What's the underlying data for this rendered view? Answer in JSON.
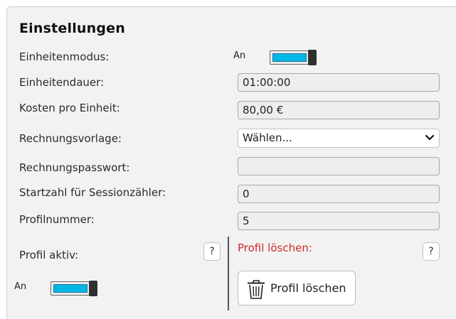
{
  "settings": {
    "title": "Einstellungen",
    "unit_mode": {
      "label": "Einheitenmodus:",
      "toggle_text": "An",
      "enabled": true
    },
    "unit_duration": {
      "label": "Einheitendauer:",
      "value": "01:00:00"
    },
    "cost_per_unit": {
      "label": "Kosten pro Einheit:",
      "value": "80,00 €"
    },
    "invoice_template": {
      "label": "Rechnungsvorlage:",
      "selected": "Wählen..."
    },
    "invoice_password": {
      "label": "Rechnungspasswort:",
      "value": ""
    },
    "session_counter_start": {
      "label": "Startzahl für Sessionzähler:",
      "value": "0"
    },
    "profile_number": {
      "label": "Profilnummer:",
      "value": "5"
    },
    "profile_active": {
      "label": "Profil aktiv:",
      "help": "?",
      "toggle_text": "An",
      "enabled": true
    },
    "delete_profile": {
      "label": "Profil löschen:",
      "help": "?",
      "button_label": "Profil löschen"
    }
  },
  "colors": {
    "toggle_on": "#00b7e6",
    "danger": "#d22a2a",
    "panel_bg": "#f2f2f2"
  }
}
